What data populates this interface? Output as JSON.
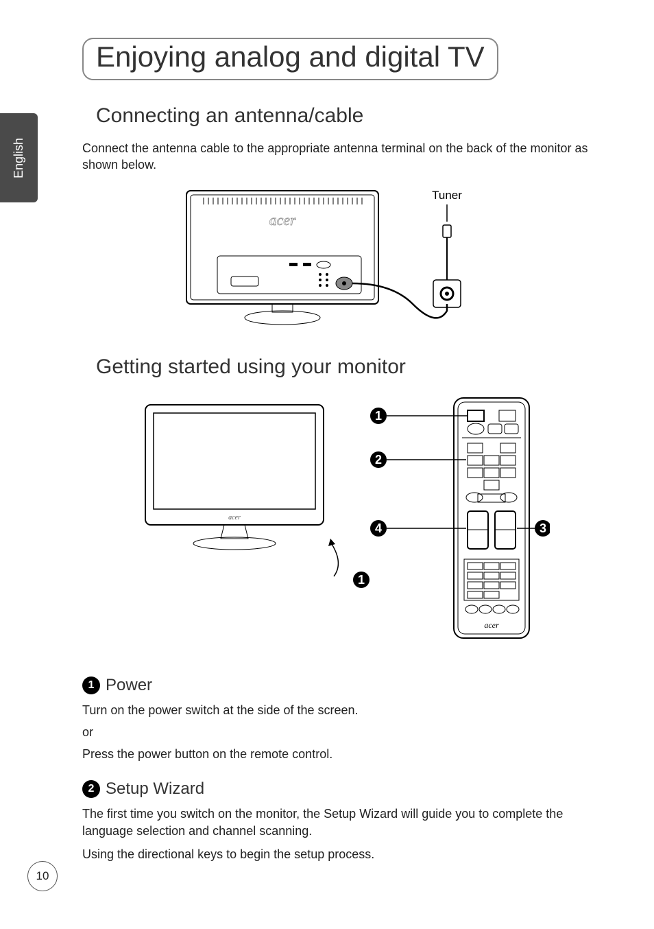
{
  "side_tab": "English",
  "title": "Enjoying analog and digital TV",
  "section1": {
    "heading": "Connecting an antenna/cable",
    "body": "Connect the antenna cable to the appropriate antenna terminal on the back of the monitor as shown below.",
    "fig_label_tuner": "Tuner",
    "fig_brand": "acer"
  },
  "section2": {
    "heading": "Getting started using your monitor",
    "fig_brand": "acer",
    "callouts": {
      "c1": "1",
      "c2": "2",
      "c3": "3",
      "c4": "4"
    }
  },
  "step1": {
    "num": "1",
    "heading": "Power",
    "line1": "Turn on the power switch at the side of the screen.",
    "line2": "or",
    "line3": "Press the power button on the remote control."
  },
  "step2": {
    "num": "2",
    "heading": "Setup Wizard",
    "para1": "The first time you switch on the monitor, the Setup Wizard will guide you to complete the language selection and channel scanning.",
    "para2": "Using the directional keys to begin the setup process."
  },
  "page_number": "10"
}
